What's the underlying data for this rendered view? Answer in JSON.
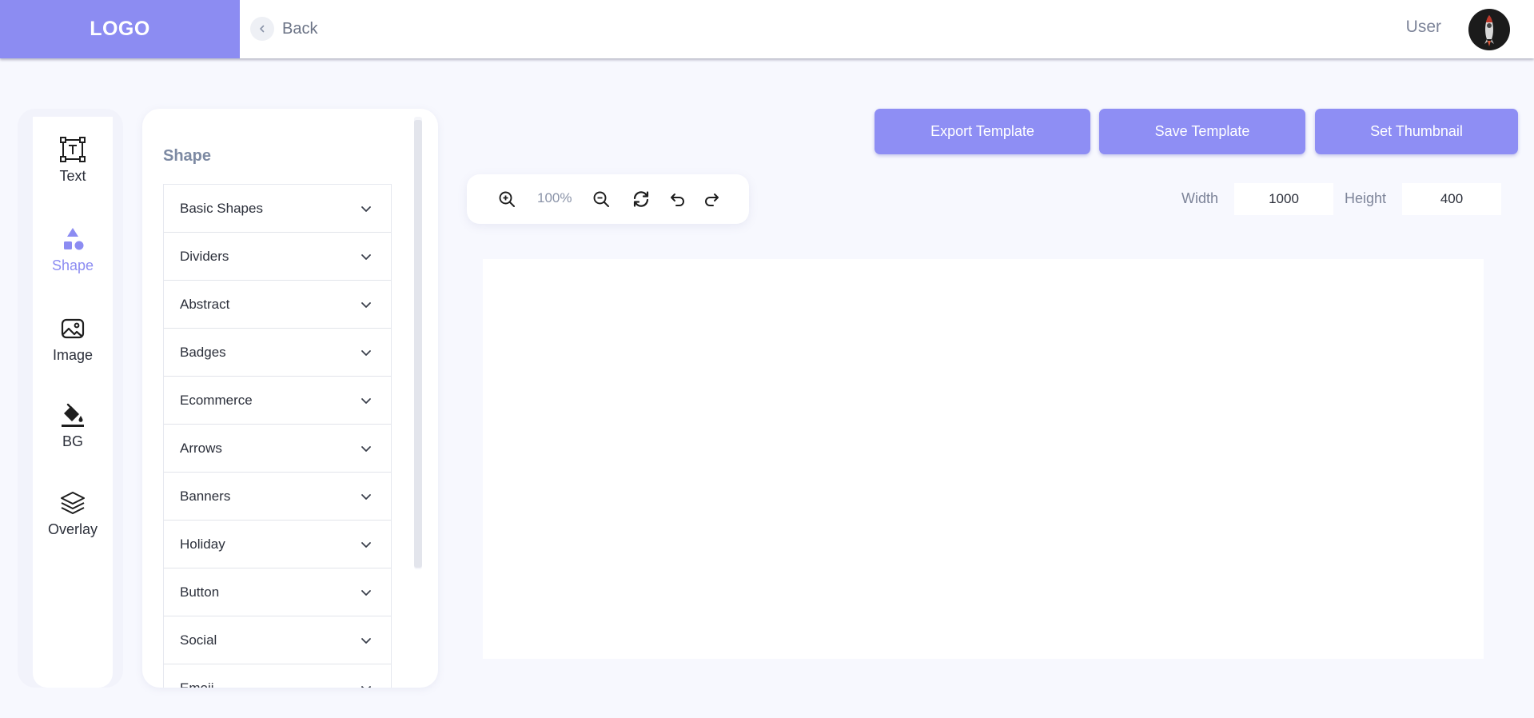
{
  "header": {
    "logo": "LOGO",
    "back_label": "Back",
    "user_label": "User"
  },
  "rail": {
    "items": [
      {
        "label": "Text",
        "icon": "text-box-icon"
      },
      {
        "label": "Shape",
        "icon": "shapes-icon",
        "active": true
      },
      {
        "label": "Image",
        "icon": "image-icon"
      },
      {
        "label": "BG",
        "icon": "paint-bucket-icon"
      },
      {
        "label": "Overlay",
        "icon": "layers-icon"
      }
    ]
  },
  "panel": {
    "title": "Shape",
    "categories": [
      "Basic Shapes",
      "Dividers",
      "Abstract",
      "Badges",
      "Ecommerce",
      "Arrows",
      "Banners",
      "Holiday",
      "Button",
      "Social",
      "Emoji"
    ]
  },
  "actions": {
    "export": "Export Template",
    "save": "Save Template",
    "thumbnail": "Set Thumbnail"
  },
  "zoom": {
    "level": "100%"
  },
  "dimensions": {
    "width_label": "Width",
    "width_value": "1000",
    "height_label": "Height",
    "height_value": "400"
  },
  "colors": {
    "accent": "#8c8cf2",
    "button": "#8e8ef4",
    "background": "#f7f8fe"
  }
}
